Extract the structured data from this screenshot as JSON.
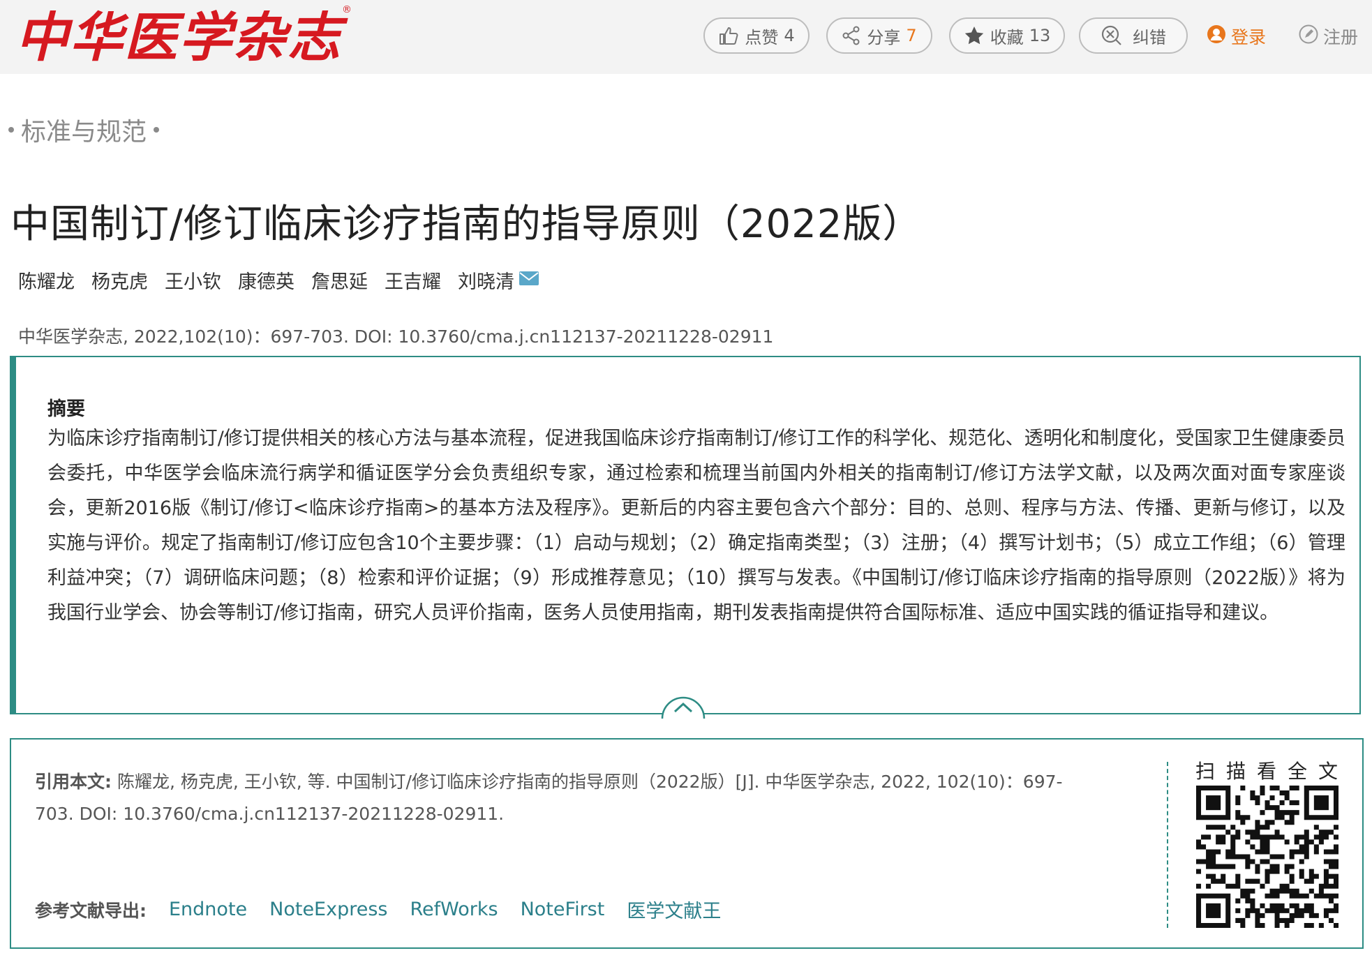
{
  "header": {
    "logo_text": "中华医学杂志",
    "logo_mark": "®",
    "like": {
      "label": "点赞",
      "count": "4",
      "icon": "thumbs-up-icon"
    },
    "share": {
      "label": "分享",
      "count": "7",
      "icon": "share-icon"
    },
    "favorite": {
      "label": "收藏",
      "count": "13",
      "icon": "star-icon"
    },
    "correction": {
      "label": "纠错",
      "icon": "error-correct-icon"
    },
    "login": {
      "label": "登录",
      "icon": "user-icon"
    },
    "register": {
      "label": "注册",
      "icon": "pencil-icon"
    }
  },
  "article": {
    "section": "标准与规范",
    "title": "中国制订/修订临床诊疗指南的指导原则（2022版）",
    "authors": [
      "陈耀龙",
      "杨克虎",
      "王小钦",
      "康德英",
      "詹思延",
      "王吉耀",
      "刘晓清"
    ],
    "citation_line": "中华医学杂志, 2022,102(10)：697-703. DOI: 10.3760/cma.j.cn112137-20211228-02911"
  },
  "abstract": {
    "heading": "摘要",
    "body": "为临床诊疗指南制订/修订提供相关的核心方法与基本流程，促进我国临床诊疗指南制订/修订工作的科学化、规范化、透明化和制度化，受国家卫生健康委员会委托，中华医学会临床流行病学和循证医学分会负责组织专家，通过检索和梳理当前国内外相关的指南制订/修订方法学文献，以及两次面对面专家座谈会，更新2016版《制订/修订<临床诊疗指南>的基本方法及程序》。更新后的内容主要包含六个部分：目的、总则、程序与方法、传播、更新与修订，以及实施与评价。规定了指南制订/修订应包含10个主要步骤：（1）启动与规划；（2）确定指南类型；（3）注册；（4）撰写计划书；（5）成立工作组；（6）管理利益冲突；（7）调研临床问题；（8）检索和评价证据；（9）形成推荐意见；（10）撰写与发表。《中国制订/修订临床诊疗指南的指导原则（2022版）》将为我国行业学会、协会等制订/修订指南，研究人员评价指南，医务人员使用指南，期刊发表指南提供符合国际标准、适应中国实践的循证指导和建议。"
  },
  "cite": {
    "label": "引用本文:",
    "text": "陈耀龙, 杨克虎, 王小钦, 等. 中国制订/修订临床诊疗指南的指导原则（2022版）[J]. 中华医学杂志, 2022, 102(10)：697-703. DOI: 10.3760/cma.j.cn112137-20211228-02911.",
    "export_label": "参考文献导出:",
    "export_links": [
      "Endnote",
      "NoteExpress",
      "RefWorks",
      "NoteFirst",
      "医学文献王"
    ],
    "qr_caption": "扫描看全文"
  },
  "colors": {
    "brand_red": "#d61920",
    "accent_teal": "#2d8c84",
    "link_teal": "#2b7f8a",
    "orange": "#e8761c"
  }
}
